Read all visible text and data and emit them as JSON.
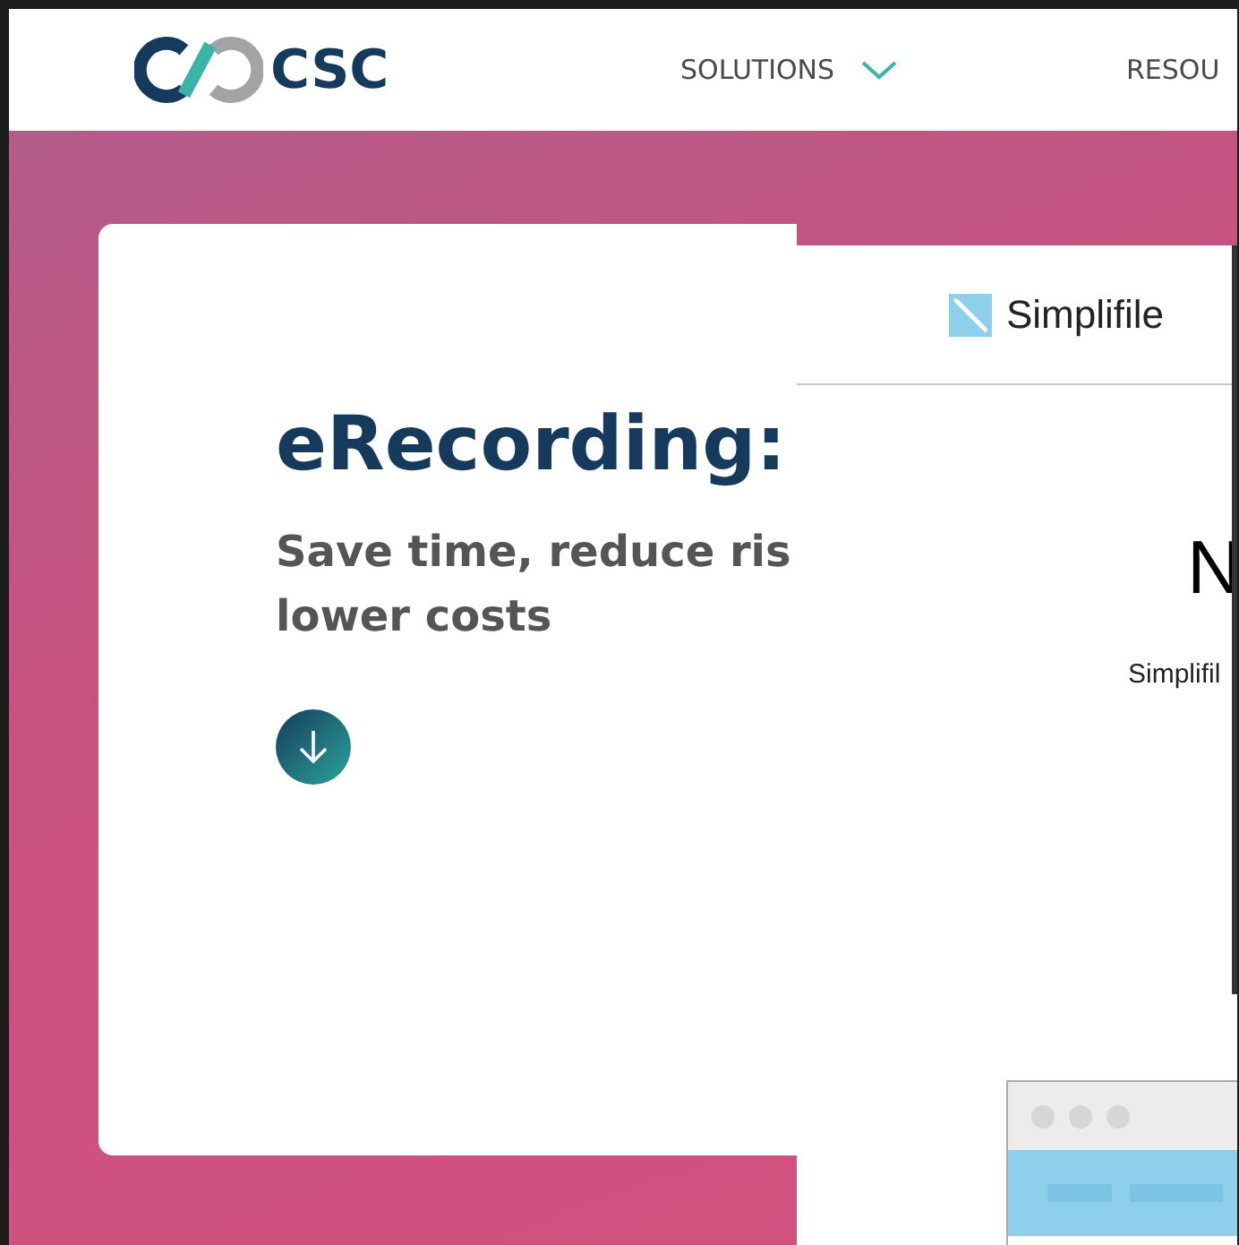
{
  "nav": {
    "logo_text": "CSC",
    "items": [
      {
        "label": "SOLUTIONS",
        "has_dropdown": true
      },
      {
        "label": "RESOU"
      }
    ]
  },
  "hero": {
    "title": "eRecording:",
    "subtitle_lines": [
      "Save time, reduce ris",
      "lower costs"
    ]
  },
  "panel": {
    "logo_text": "Simplifile",
    "heading": "N",
    "text": "Simplifil"
  }
}
